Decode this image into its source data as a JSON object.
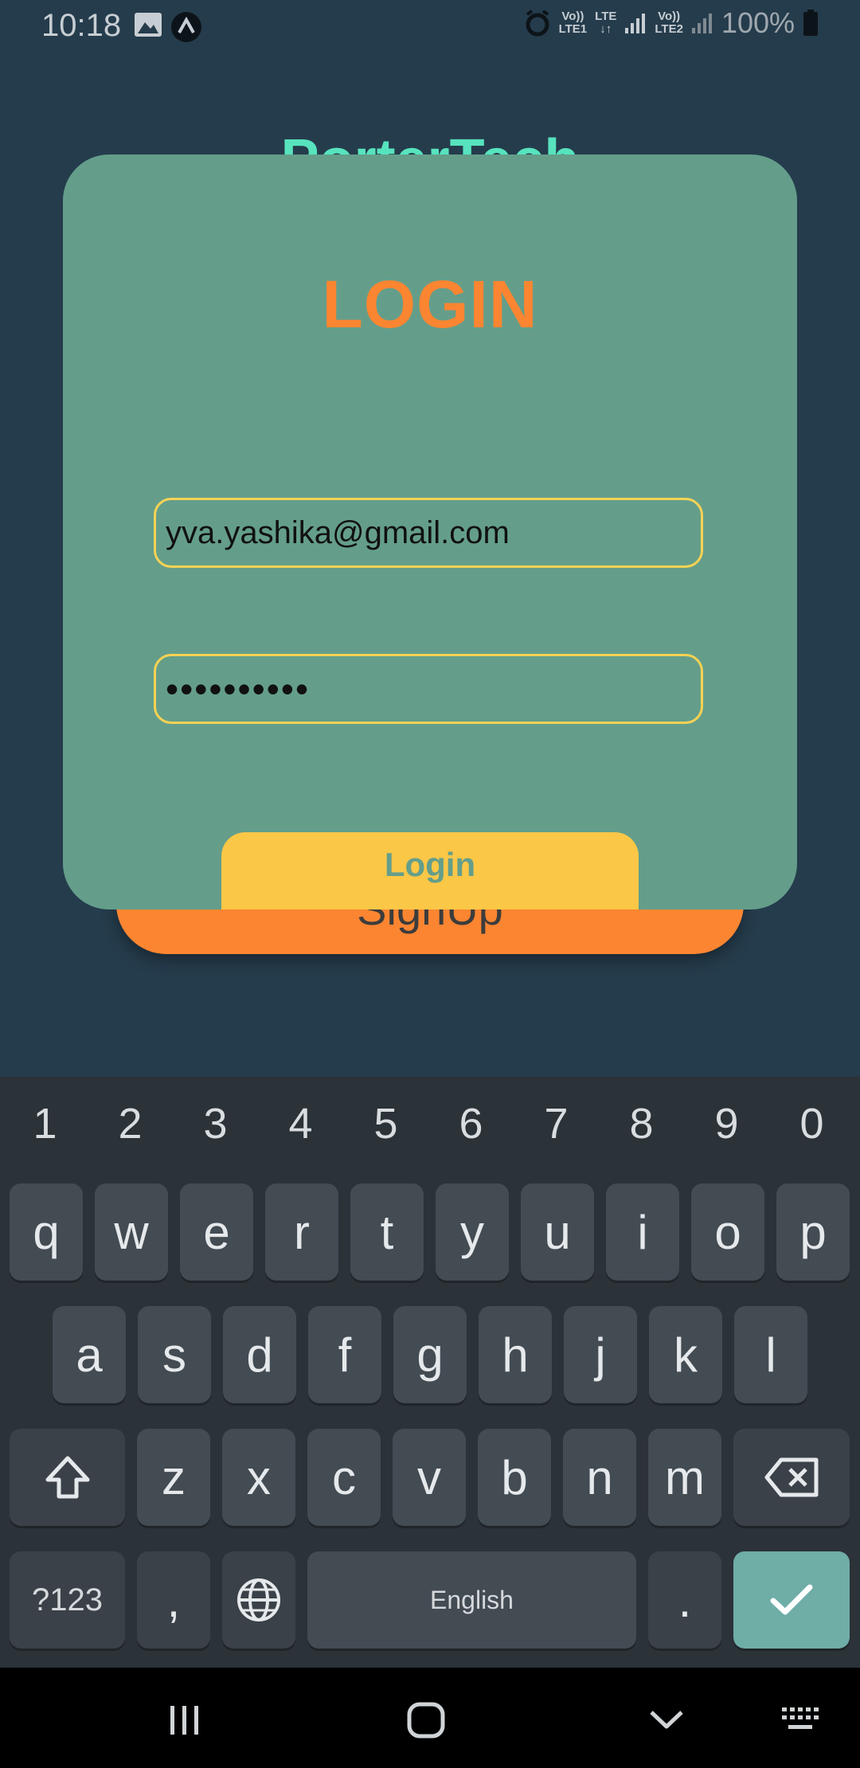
{
  "status_bar": {
    "time": "10:18",
    "battery": "100%",
    "sim1_label_top": "Vo))",
    "sim1_label_bottom": "LTE1",
    "data_label": "LTE",
    "sim2_label_top": "Vo))",
    "sim2_label_bottom": "LTE2",
    "icons": [
      "gallery-icon",
      "app-notification-icon",
      "alarm-icon",
      "signal-icon",
      "battery-icon"
    ]
  },
  "background": {
    "app_title": "PorterTech",
    "signup_label": "SignUp"
  },
  "login_modal": {
    "heading": "LOGIN",
    "email_value": "yva.yashika@gmail.com",
    "password_value": "••••••••••",
    "button_label": "Login"
  },
  "keyboard": {
    "number_row": [
      "1",
      "2",
      "3",
      "4",
      "5",
      "6",
      "7",
      "8",
      "9",
      "0"
    ],
    "row1": [
      "q",
      "w",
      "e",
      "r",
      "t",
      "y",
      "u",
      "i",
      "o",
      "p"
    ],
    "row2": [
      "a",
      "s",
      "d",
      "f",
      "g",
      "h",
      "j",
      "k",
      "l"
    ],
    "row3": [
      "z",
      "x",
      "c",
      "v",
      "b",
      "n",
      "m"
    ],
    "symbols_label": "?123",
    "comma_label": ",",
    "space_label": "English",
    "period_label": ".",
    "icons": [
      "shift-icon",
      "backspace-icon",
      "globe-icon",
      "checkmark-icon"
    ]
  },
  "nav_bar": {
    "icons": [
      "recents-icon",
      "home-icon",
      "back-chevron-icon",
      "keyboard-icon"
    ]
  },
  "colors": {
    "background": "#253c4c",
    "modal": "#649e8a",
    "accent_orange": "#fb8531",
    "accent_yellow": "#fbc747",
    "title_mint": "#57e3bd"
  }
}
